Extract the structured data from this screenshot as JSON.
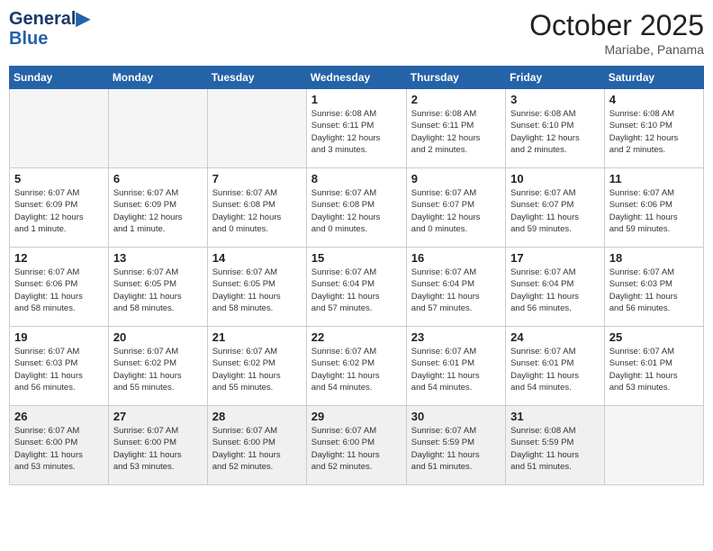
{
  "header": {
    "logo_line1": "General",
    "logo_line2": "Blue",
    "month": "October 2025",
    "location": "Mariabe, Panama"
  },
  "days_of_week": [
    "Sunday",
    "Monday",
    "Tuesday",
    "Wednesday",
    "Thursday",
    "Friday",
    "Saturday"
  ],
  "weeks": [
    [
      {
        "day": "",
        "empty": true
      },
      {
        "day": "",
        "empty": true
      },
      {
        "day": "",
        "empty": true
      },
      {
        "day": "1",
        "sunrise": "6:08 AM",
        "sunset": "6:11 PM",
        "daylight": "12 hours and 3 minutes."
      },
      {
        "day": "2",
        "sunrise": "6:08 AM",
        "sunset": "6:11 PM",
        "daylight": "12 hours and 2 minutes."
      },
      {
        "day": "3",
        "sunrise": "6:08 AM",
        "sunset": "6:10 PM",
        "daylight": "12 hours and 2 minutes."
      },
      {
        "day": "4",
        "sunrise": "6:08 AM",
        "sunset": "6:10 PM",
        "daylight": "12 hours and 2 minutes."
      }
    ],
    [
      {
        "day": "5",
        "sunrise": "6:07 AM",
        "sunset": "6:09 PM",
        "daylight": "12 hours and 1 minute."
      },
      {
        "day": "6",
        "sunrise": "6:07 AM",
        "sunset": "6:09 PM",
        "daylight": "12 hours and 1 minute."
      },
      {
        "day": "7",
        "sunrise": "6:07 AM",
        "sunset": "6:08 PM",
        "daylight": "12 hours and 0 minutes."
      },
      {
        "day": "8",
        "sunrise": "6:07 AM",
        "sunset": "6:08 PM",
        "daylight": "12 hours and 0 minutes."
      },
      {
        "day": "9",
        "sunrise": "6:07 AM",
        "sunset": "6:07 PM",
        "daylight": "12 hours and 0 minutes."
      },
      {
        "day": "10",
        "sunrise": "6:07 AM",
        "sunset": "6:07 PM",
        "daylight": "11 hours and 59 minutes."
      },
      {
        "day": "11",
        "sunrise": "6:07 AM",
        "sunset": "6:06 PM",
        "daylight": "11 hours and 59 minutes."
      }
    ],
    [
      {
        "day": "12",
        "sunrise": "6:07 AM",
        "sunset": "6:06 PM",
        "daylight": "11 hours and 58 minutes."
      },
      {
        "day": "13",
        "sunrise": "6:07 AM",
        "sunset": "6:05 PM",
        "daylight": "11 hours and 58 minutes."
      },
      {
        "day": "14",
        "sunrise": "6:07 AM",
        "sunset": "6:05 PM",
        "daylight": "11 hours and 58 minutes."
      },
      {
        "day": "15",
        "sunrise": "6:07 AM",
        "sunset": "6:04 PM",
        "daylight": "11 hours and 57 minutes."
      },
      {
        "day": "16",
        "sunrise": "6:07 AM",
        "sunset": "6:04 PM",
        "daylight": "11 hours and 57 minutes."
      },
      {
        "day": "17",
        "sunrise": "6:07 AM",
        "sunset": "6:04 PM",
        "daylight": "11 hours and 56 minutes."
      },
      {
        "day": "18",
        "sunrise": "6:07 AM",
        "sunset": "6:03 PM",
        "daylight": "11 hours and 56 minutes."
      }
    ],
    [
      {
        "day": "19",
        "sunrise": "6:07 AM",
        "sunset": "6:03 PM",
        "daylight": "11 hours and 56 minutes."
      },
      {
        "day": "20",
        "sunrise": "6:07 AM",
        "sunset": "6:02 PM",
        "daylight": "11 hours and 55 minutes."
      },
      {
        "day": "21",
        "sunrise": "6:07 AM",
        "sunset": "6:02 PM",
        "daylight": "11 hours and 55 minutes."
      },
      {
        "day": "22",
        "sunrise": "6:07 AM",
        "sunset": "6:02 PM",
        "daylight": "11 hours and 54 minutes."
      },
      {
        "day": "23",
        "sunrise": "6:07 AM",
        "sunset": "6:01 PM",
        "daylight": "11 hours and 54 minutes."
      },
      {
        "day": "24",
        "sunrise": "6:07 AM",
        "sunset": "6:01 PM",
        "daylight": "11 hours and 54 minutes."
      },
      {
        "day": "25",
        "sunrise": "6:07 AM",
        "sunset": "6:01 PM",
        "daylight": "11 hours and 53 minutes."
      }
    ],
    [
      {
        "day": "26",
        "sunrise": "6:07 AM",
        "sunset": "6:00 PM",
        "daylight": "11 hours and 53 minutes."
      },
      {
        "day": "27",
        "sunrise": "6:07 AM",
        "sunset": "6:00 PM",
        "daylight": "11 hours and 53 minutes."
      },
      {
        "day": "28",
        "sunrise": "6:07 AM",
        "sunset": "6:00 PM",
        "daylight": "11 hours and 52 minutes."
      },
      {
        "day": "29",
        "sunrise": "6:07 AM",
        "sunset": "6:00 PM",
        "daylight": "11 hours and 52 minutes."
      },
      {
        "day": "30",
        "sunrise": "6:07 AM",
        "sunset": "5:59 PM",
        "daylight": "11 hours and 51 minutes."
      },
      {
        "day": "31",
        "sunrise": "6:08 AM",
        "sunset": "5:59 PM",
        "daylight": "11 hours and 51 minutes."
      },
      {
        "day": "",
        "empty": true
      }
    ]
  ]
}
